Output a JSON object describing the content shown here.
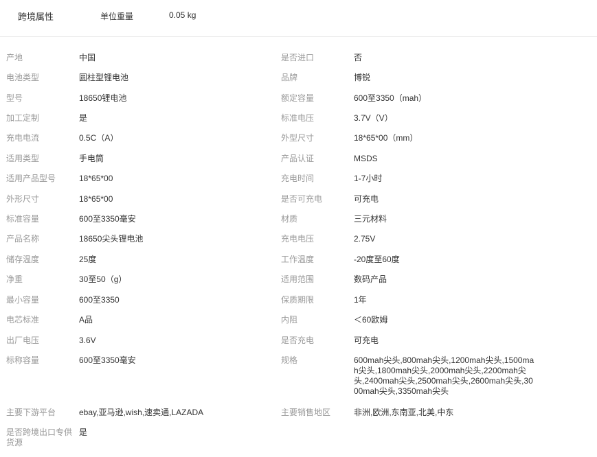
{
  "header": {
    "section_title": "跨境属性",
    "weight_label": "单位重量",
    "weight_value": "0.05 kg"
  },
  "attributes_left": [
    {
      "label": "产地",
      "value": "中国"
    },
    {
      "label": "电池类型",
      "value": "圆柱型锂电池"
    },
    {
      "label": "型号",
      "value": "18650锂电池"
    },
    {
      "label": "加工定制",
      "value": "是"
    },
    {
      "label": "充电电流",
      "value": "0.5C（A）"
    },
    {
      "label": "适用类型",
      "value": "手电筒"
    },
    {
      "label": "适用产品型号",
      "value": "18*65*00"
    },
    {
      "label": "外形尺寸",
      "value": "18*65*00"
    },
    {
      "label": "标准容量",
      "value": "600至3350毫安"
    },
    {
      "label": "产品名称",
      "value": "18650尖头锂电池"
    },
    {
      "label": "储存温度",
      "value": "25度"
    },
    {
      "label": "净重",
      "value": "30至50（g）"
    },
    {
      "label": "最小容量",
      "value": "600至3350"
    },
    {
      "label": "电芯标准",
      "value": "A品"
    },
    {
      "label": "出厂电压",
      "value": "3.6V"
    },
    {
      "label": "标称容量",
      "value": "600至3350毫安"
    },
    {
      "label": "主要下游平台",
      "value": "ebay,亚马逊,wish,速卖通,LAZADA"
    },
    {
      "label": "是否跨境出口专供货源",
      "value": "是"
    }
  ],
  "attributes_right": [
    {
      "label": "是否进口",
      "value": "否"
    },
    {
      "label": "品牌",
      "value": "博锐"
    },
    {
      "label": "额定容量",
      "value": "600至3350（mah）"
    },
    {
      "label": "标准电压",
      "value": "3.7V（V）"
    },
    {
      "label": "外型尺寸",
      "value": "18*65*00（mm）"
    },
    {
      "label": "产品认证",
      "value": "MSDS"
    },
    {
      "label": "充电时间",
      "value": "1-7小时"
    },
    {
      "label": "是否可充电",
      "value": "可充电"
    },
    {
      "label": "材质",
      "value": "三元材料"
    },
    {
      "label": "充电电压",
      "value": "2.75V"
    },
    {
      "label": "工作温度",
      "value": "-20度至60度"
    },
    {
      "label": "适用范围",
      "value": "数码产品"
    },
    {
      "label": "保质期限",
      "value": "1年"
    },
    {
      "label": "内阻",
      "value": "＜60欧姆"
    },
    {
      "label": "是否充电",
      "value": "可充电"
    },
    {
      "label": "规格",
      "value": "600mah尖头,800mah尖头,1200mah尖头,1500mah尖头,1800mah尖头,2000mah尖头,2200mah尖头,2400mah尖头,2500mah尖头,2600mah尖头,3000mah尖头,3350mah尖头"
    },
    {
      "label": "主要销售地区",
      "value": "非洲,欧洲,东南亚,北美,中东"
    }
  ]
}
